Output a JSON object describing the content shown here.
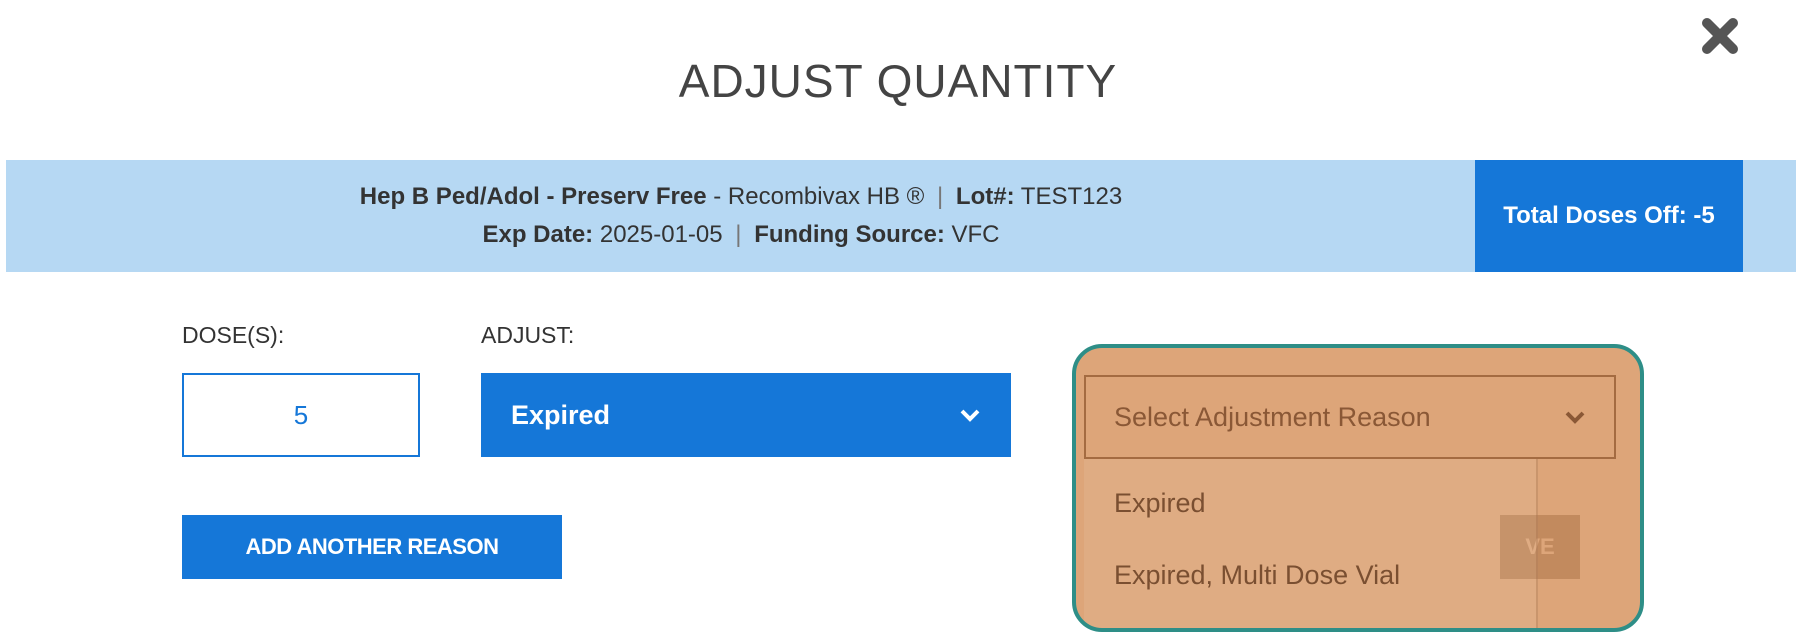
{
  "dialog": {
    "title": "ADJUST QUANTITY",
    "close_icon": "close-icon"
  },
  "vaccine": {
    "name": "Hep B Ped/Adol - Preserv Free",
    "brand": "- Recombivax HB ®",
    "lot_label": "Lot#:",
    "lot_value": "TEST123",
    "exp_label": "Exp Date:",
    "exp_value": "2025-01-05",
    "funding_label": "Funding Source:",
    "funding_value": "VFC",
    "separator": "|"
  },
  "total": {
    "label": "Total Doses Off: -5"
  },
  "form": {
    "doses_label": "DOSE(S):",
    "doses_value": "5",
    "adjust_label": "ADJUST:",
    "adjust_value": "Expired",
    "reason_placeholder": "Select Adjustment Reason",
    "reason_options": [
      "Expired",
      "Expired, Multi Dose Vial"
    ],
    "add_reason_label": "ADD ANOTHER REASON",
    "save_label_visible": "VE"
  },
  "colors": {
    "primary": "#1577d8",
    "info_bar": "#b6d8f3",
    "highlight_fill": "#d6915c",
    "highlight_border": "#2e8e87"
  }
}
